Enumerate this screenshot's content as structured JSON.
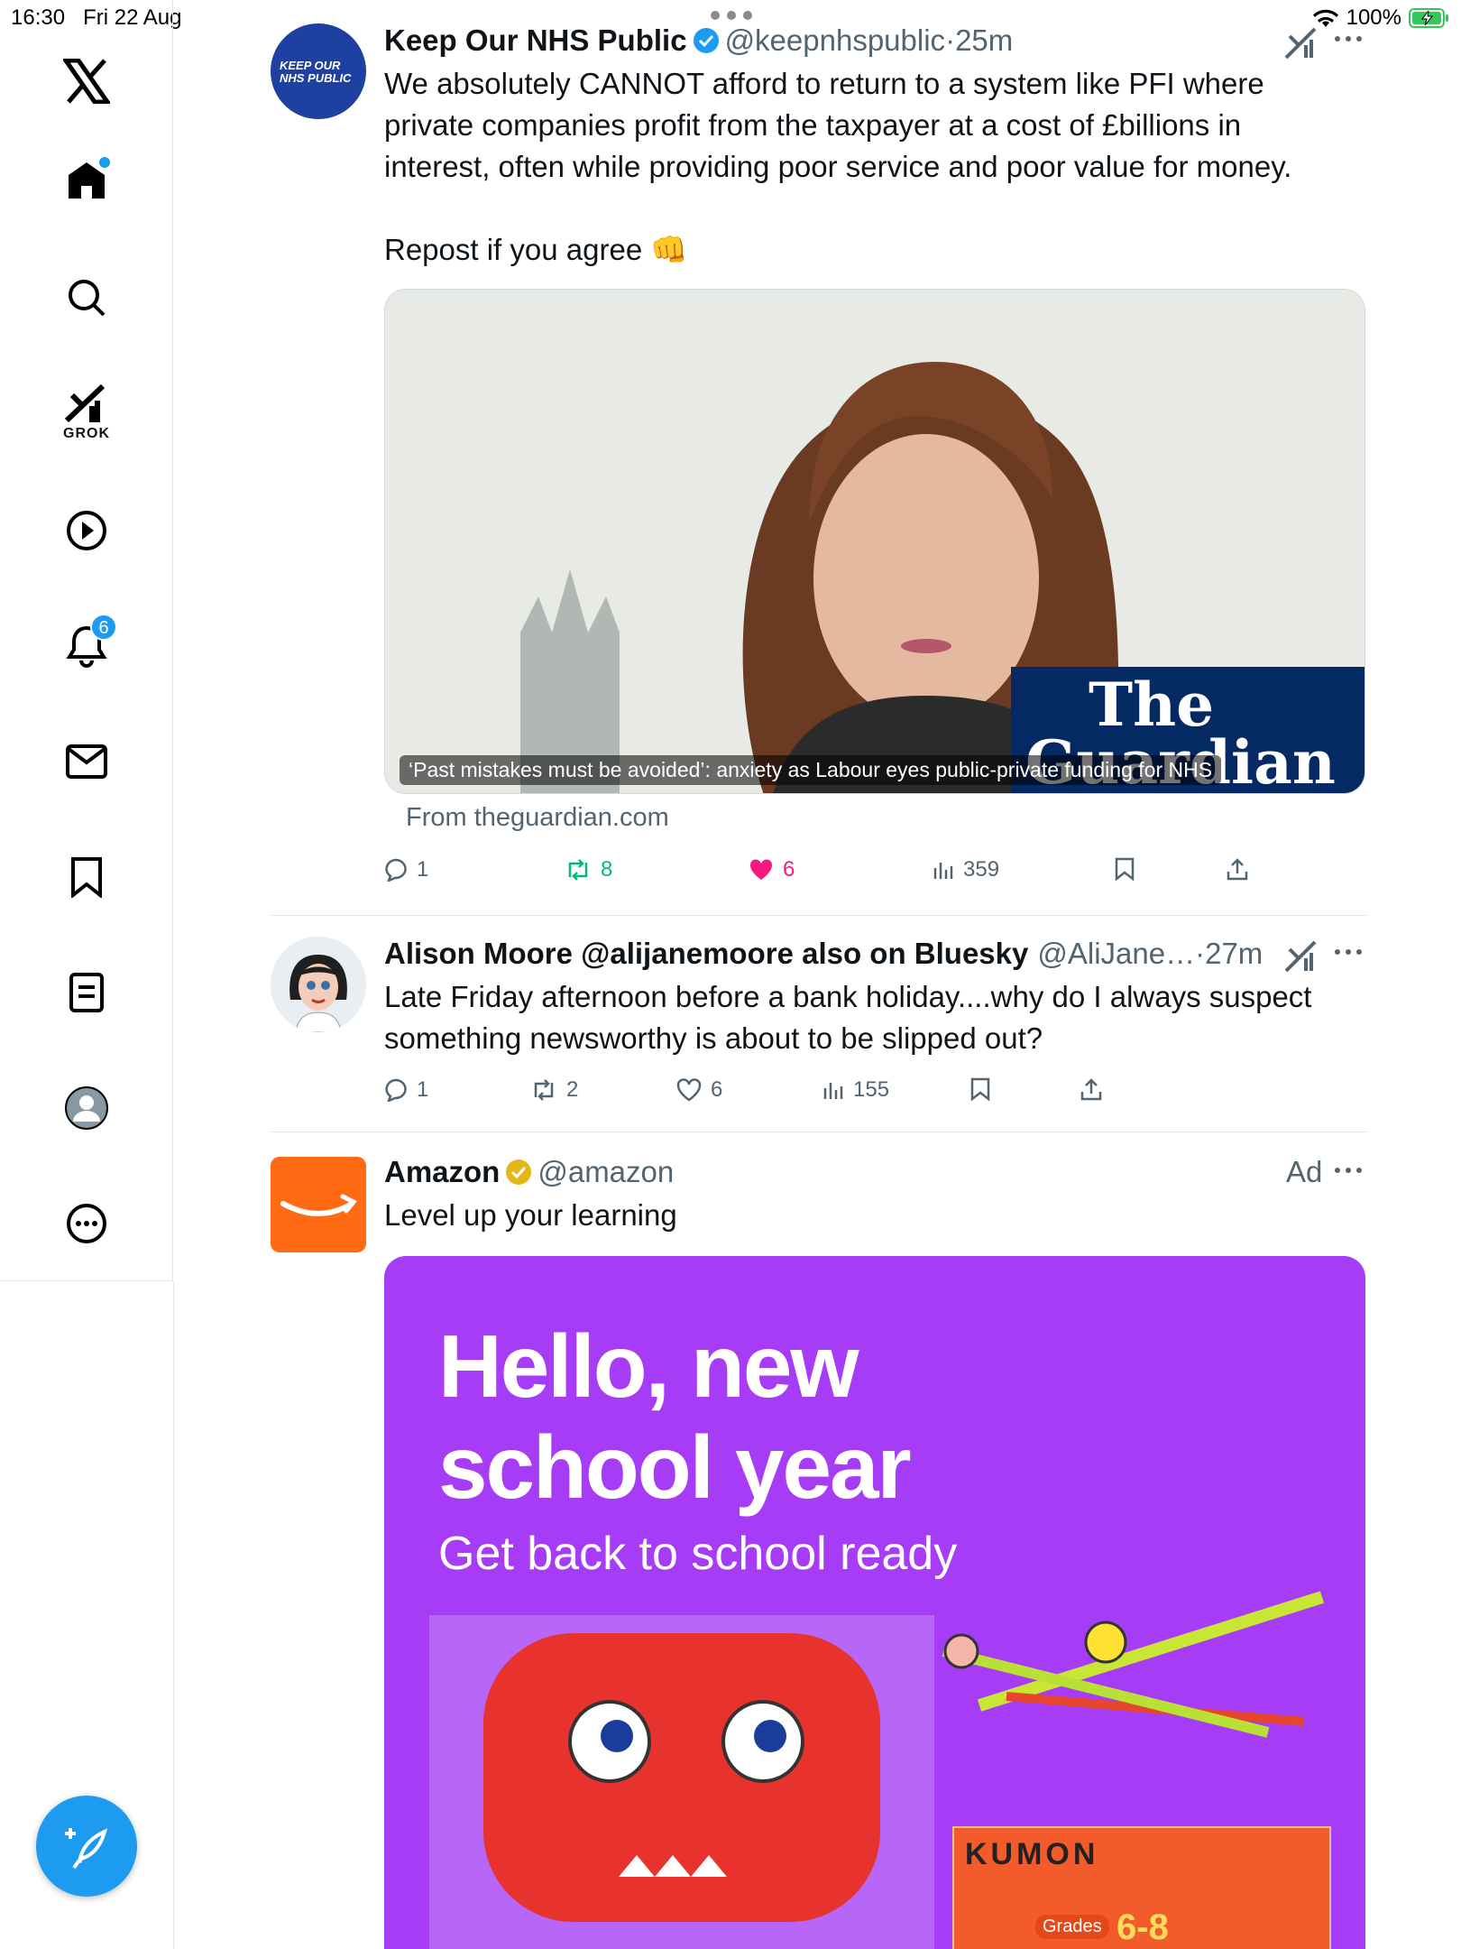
{
  "status_bar": {
    "time": "16:30",
    "date": "Fri 22 Aug",
    "battery": "100%"
  },
  "sidebar": {
    "items": [
      {
        "name": "x-logo",
        "label": ""
      },
      {
        "name": "home",
        "label": ""
      },
      {
        "name": "search",
        "label": ""
      },
      {
        "name": "grok",
        "label": "GROK"
      },
      {
        "name": "video",
        "label": ""
      },
      {
        "name": "notifications",
        "label": "",
        "badge": "6"
      },
      {
        "name": "messages",
        "label": ""
      },
      {
        "name": "bookmarks",
        "label": ""
      },
      {
        "name": "lists",
        "label": ""
      },
      {
        "name": "profile",
        "label": ""
      },
      {
        "name": "more",
        "label": ""
      }
    ]
  },
  "posts": [
    {
      "avatar_text": "KEEP OUR NHS PUBLIC",
      "name": "Keep Our NHS Public",
      "handle": "@keepnhspublic",
      "dot": "·",
      "ago": "25m",
      "text_lines": [
        "We absolutely CANNOT afford to return to a system like PFI where",
        "private companies profit from the taxpayer at a cost of £billions in",
        "interest, often while providing poor service and poor value for money."
      ],
      "text_repost": "Repost if you agree 👊",
      "card": {
        "caption": "‘Past mistakes must be avoided’: anxiety as Labour eyes public-private funding for NHS",
        "logo_line1": "The",
        "logo_line2": "Guardian",
        "from": "From theguardian.com"
      },
      "stats": {
        "replies": "1",
        "reposts": "8",
        "likes": "6",
        "views": "359"
      }
    },
    {
      "name": "Alison Moore @alijanemoore also on Bluesky",
      "handle": "@AliJane…",
      "dot": "·",
      "ago": "27m",
      "text_lines": [
        "Late Friday afternoon before a bank holiday....why do I always suspect",
        "something newsworthy is about to be slipped out?"
      ],
      "stats": {
        "replies": "1",
        "reposts": "2",
        "likes": "6",
        "views": "155"
      }
    },
    {
      "name": "Amazon",
      "handle": "@amazon",
      "ad_label": "Ad",
      "text": "Level up your learning",
      "ad": {
        "headline_line1": "Hello, new",
        "headline_line2": "school year",
        "subhead": "Get back to school ready",
        "box_brand": "KUMON",
        "box_grades": "Grades",
        "box_range": "6-8"
      }
    }
  ],
  "colors": {
    "accent": "#1d9bf0",
    "like": "#f91880",
    "repost": "#00ba7c",
    "ad_bg": "#a63cf6",
    "guardian": "#052962"
  }
}
